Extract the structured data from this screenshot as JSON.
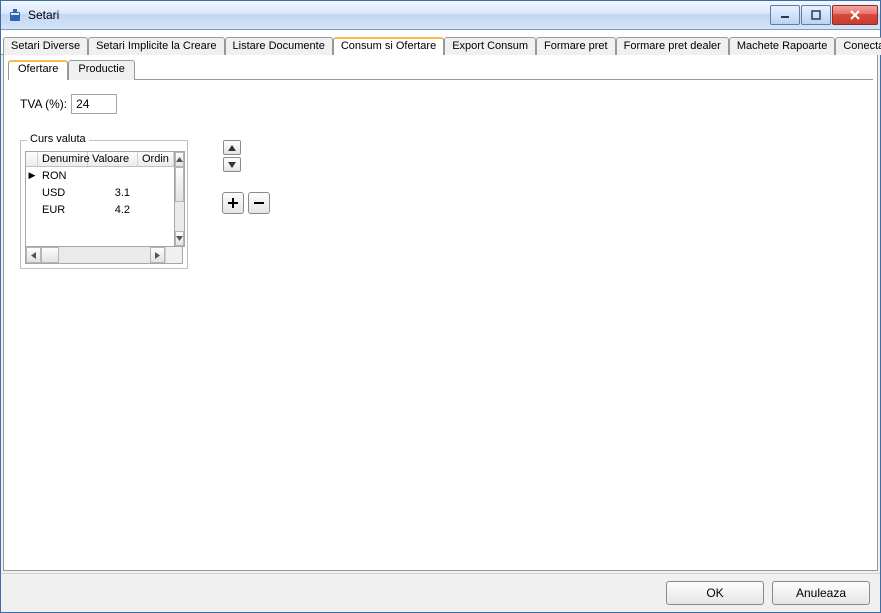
{
  "window": {
    "title": "Setari"
  },
  "main_tabs": {
    "items": [
      "Setari Diverse",
      "Setari Implicite la Creare",
      "Listare Documente",
      "Consum si Ofertare",
      "Export Consum",
      "Formare pret",
      "Formare pret dealer",
      "Machete Rapoarte",
      "Conecta"
    ],
    "active_index": 3
  },
  "sub_tabs": {
    "items": [
      "Ofertare",
      "Productie"
    ],
    "active_index": 0
  },
  "tva": {
    "label": "TVA (%):",
    "value": "24"
  },
  "currency_group": {
    "label": "Curs valuta",
    "columns": {
      "name": "Denumire",
      "value": "Valoare",
      "order": "Ordin"
    },
    "rows": [
      {
        "name": "RON",
        "value": "",
        "current": true
      },
      {
        "name": "USD",
        "value": "3.1",
        "current": false
      },
      {
        "name": "EUR",
        "value": "4.2",
        "current": false
      }
    ]
  },
  "footer": {
    "ok": "OK",
    "cancel": "Anuleaza"
  }
}
